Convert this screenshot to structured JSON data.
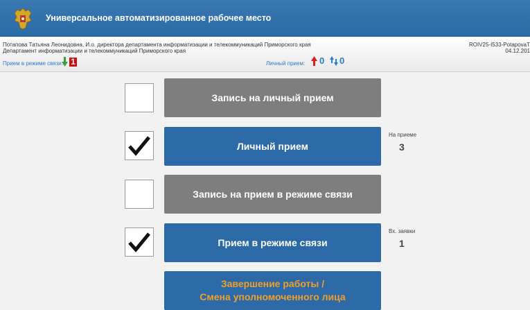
{
  "header": {
    "app_title": "Универсальное автоматизированное рабочее место",
    "emblem_icon": "coat-of-arms-icon",
    "background": "#2b6aa6"
  },
  "user": {
    "line1": "Потапова Татьяна Леонидовна, И.о. директора департамента информатизации и телекоммуникаций Приморского края",
    "line2": "Департамент информатизации и телекоммуникаций Приморского края",
    "workstation": "ROIV25-I533-PotapovaT",
    "date": "04.12.201"
  },
  "status": {
    "remote_label": "Прием в режиме связи:",
    "remote_badge": "1",
    "personal_label": "Личный прием:",
    "personal_count_1": "0",
    "personal_count_2": "0"
  },
  "actions": [
    {
      "label": "Запись на личный прием",
      "checked": false
    },
    {
      "label": "Личный прием",
      "checked": true,
      "counter_label": "На приеме",
      "counter_value": "3"
    },
    {
      "label": "Запись на прием в режиме связи",
      "checked": false
    },
    {
      "label": "Прием в режиме связи",
      "checked": true,
      "counter_label": "Вх. заявки",
      "counter_value": "1"
    }
  ],
  "finish": {
    "line1": "Завершение работы /",
    "line2": "Смена уполномоченного лица"
  },
  "colors": {
    "accent_blue": "#2b6aa6",
    "gray_button": "#7e7e7e",
    "orange_text": "#f0a02a",
    "badge_red": "#cc1010"
  }
}
